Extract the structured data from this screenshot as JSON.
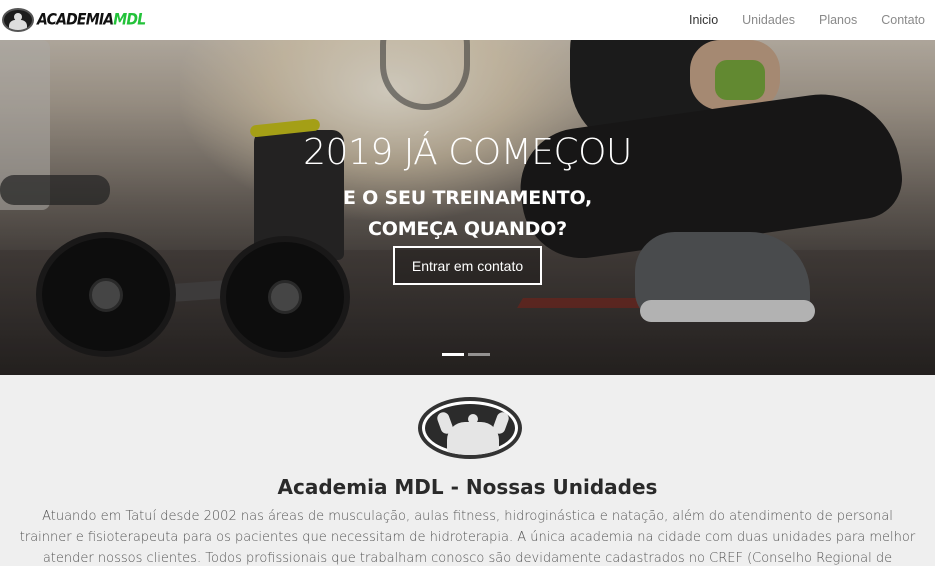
{
  "header": {
    "brand": {
      "name_main": "ACADEMIA",
      "name_accent": "MDL"
    },
    "nav": [
      {
        "label": "Inicio",
        "active": true
      },
      {
        "label": "Unidades",
        "active": false
      },
      {
        "label": "Planos",
        "active": false
      },
      {
        "label": "Contato",
        "active": false
      }
    ]
  },
  "hero": {
    "title": "2019 JÁ COMEÇOU",
    "subtitle_line1": "E O SEU TREINAMENTO,",
    "subtitle_line2": "COMEÇA QUANDO?",
    "cta_label": "Entrar em contato",
    "slides": 2,
    "active_slide": 1
  },
  "section": {
    "title": "Academia MDL - Nossas Unidades",
    "text": "Atuando em Tatuí desde 2002 nas áreas de musculação, aulas fitness, hidroginástica e natação, além do atendimento de personal trainner e fisioterapeuta para os pacientes que necessitam de hidroterapia. A única academia na cidade com duas unidades para melhor atender nossos clientes. Todos profissionais que trabalham conosco são devidamente cadastrados no CREF (Conselho Regional de Educação Física)."
  },
  "colors": {
    "brand_accent": "#23c23a",
    "nav_active": "#333333",
    "nav_inactive": "#8a8a8a",
    "section_bg": "#efefef"
  }
}
